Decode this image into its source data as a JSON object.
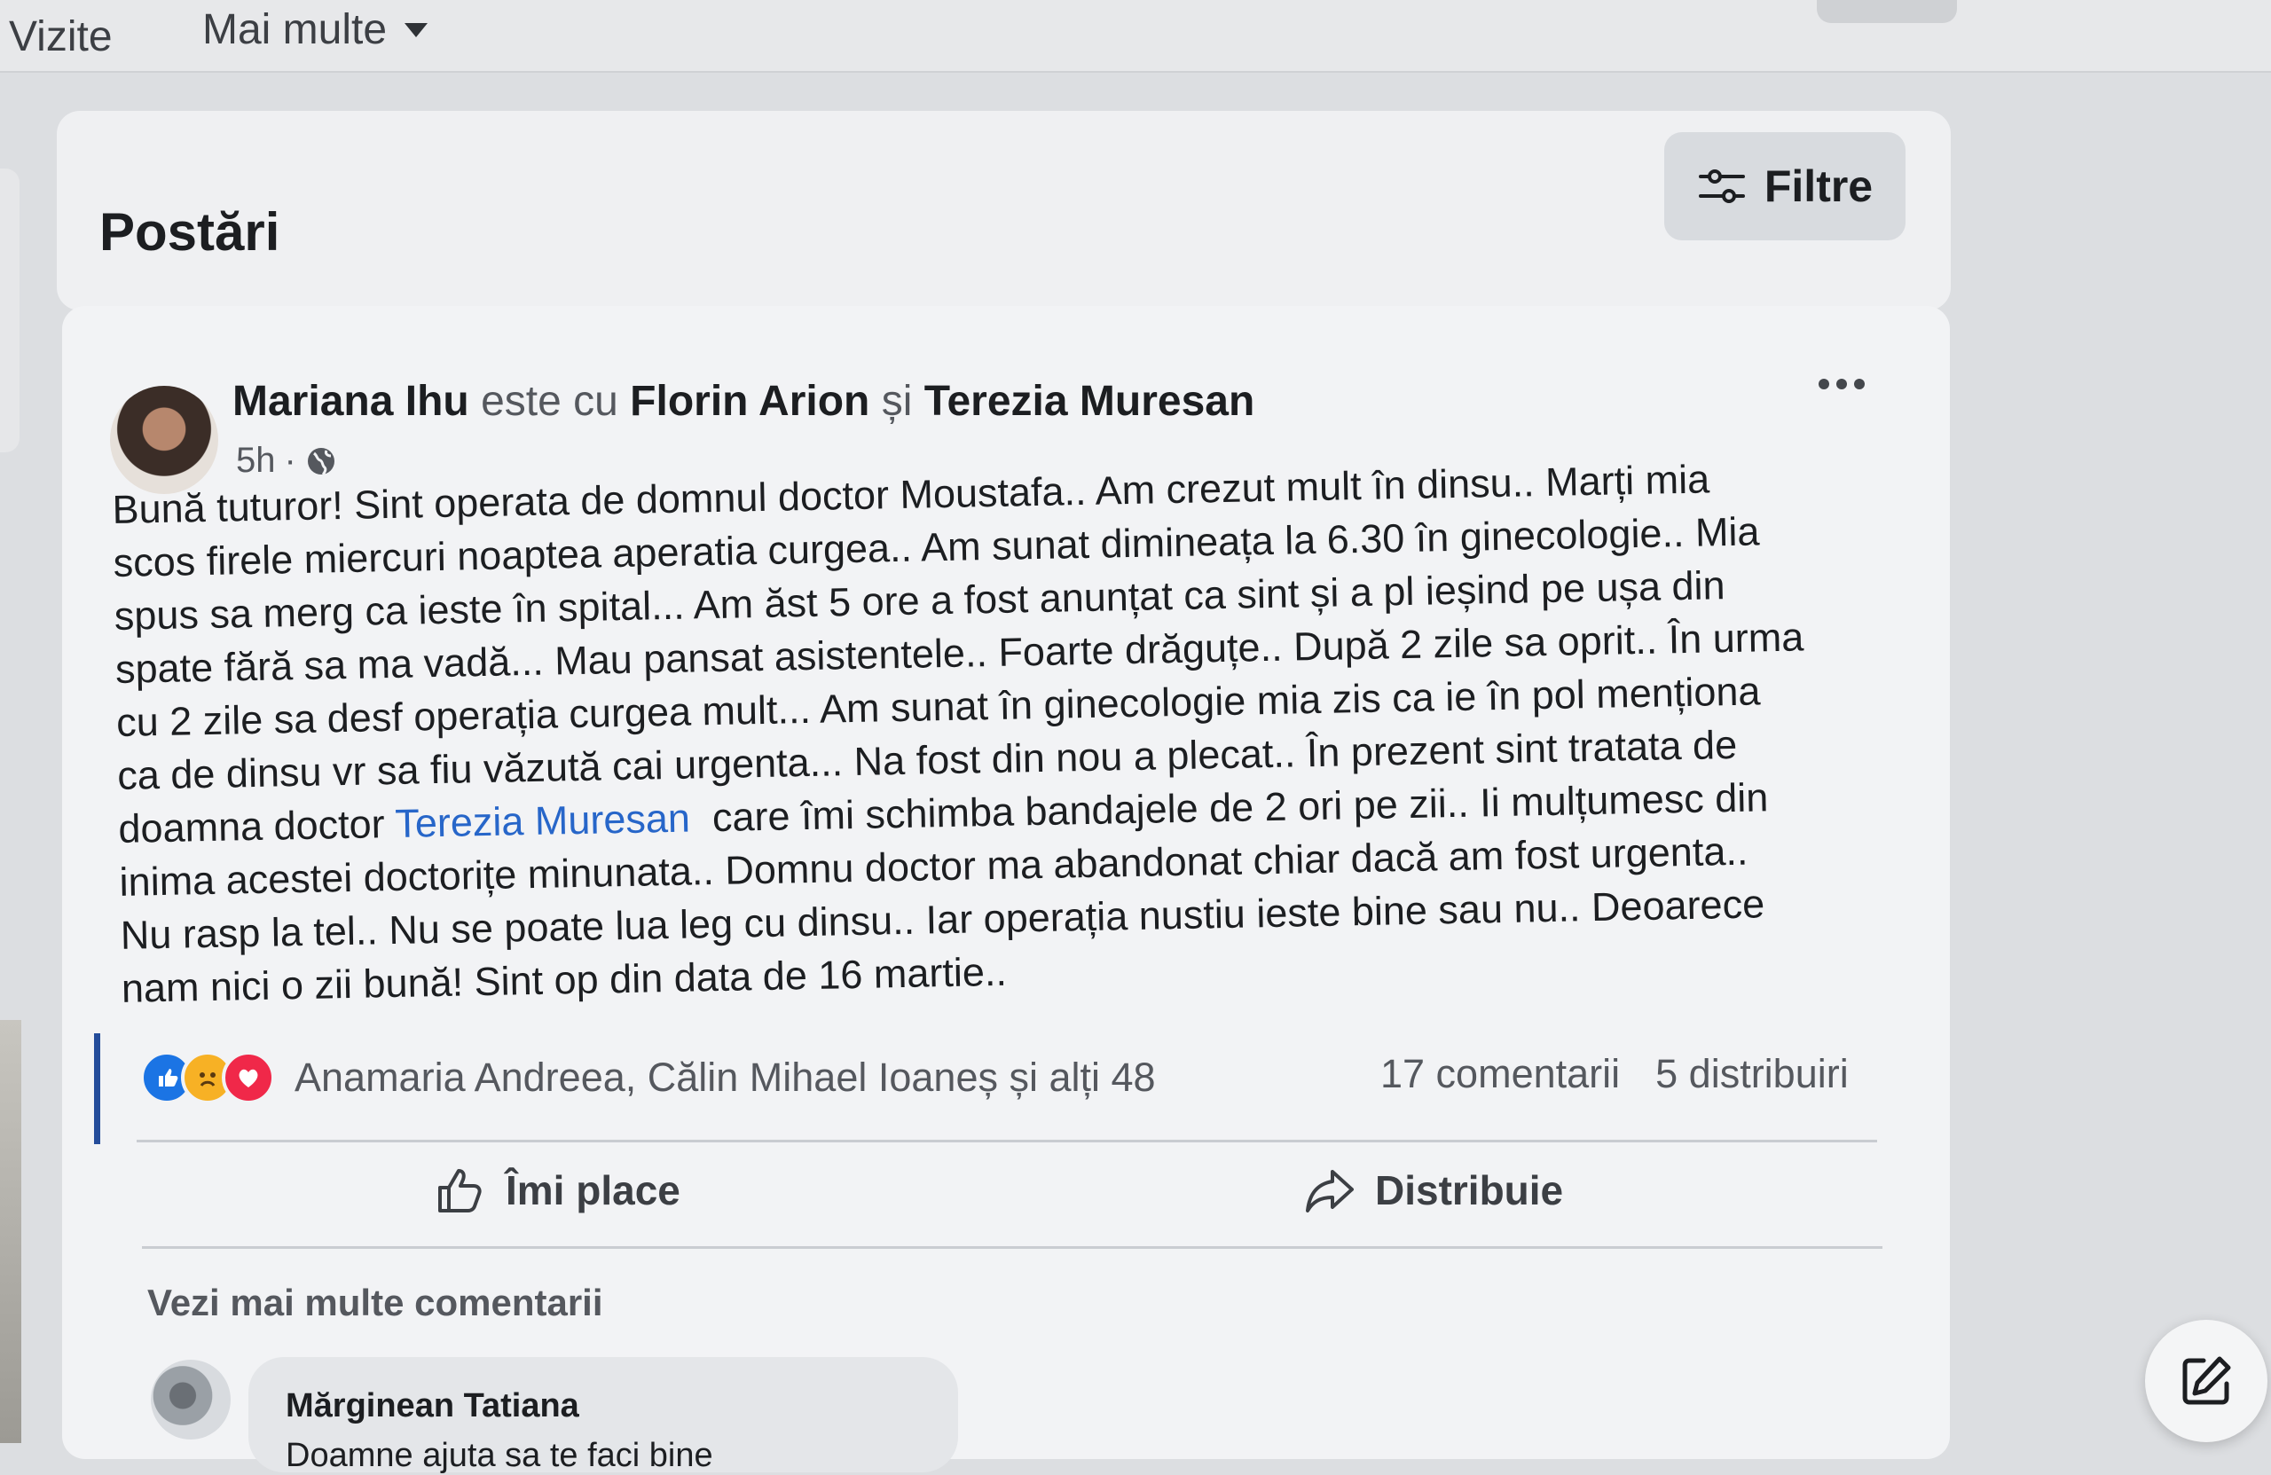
{
  "nav": {
    "items": [
      "Vizite",
      "Mai multe"
    ]
  },
  "posts_section": {
    "title": "Postări",
    "filter_label": "Filtre"
  },
  "post": {
    "author": "Mariana Ihu",
    "with_text": "este cu",
    "tagged_1": "Florin Arion",
    "and_text": "și",
    "tagged_2": "Terezia Muresan",
    "time": "5h",
    "separator": "·",
    "body_lines": [
      "Bună tuturor! Sint operata de domnul doctor  Moustafa.. Am crezut mult în dinsu.. Marți mia",
      "scos firele miercuri noaptea aperatia curgea.. Am sunat dimineața la 6.30 în ginecologie.. Mia",
      "spus sa merg ca ieste în spital... Am ăst 5 ore a fost anunțat ca sint și a pl ieșind pe ușa din",
      "spate fără sa ma vadă... Mau pansat asistentele.. Foarte drăguțe.. După 2 zile sa oprit.. În urma",
      "cu 2 zile sa desf operația curgea mult... Am sunat în ginecologie mia zis ca ie în pol menționa",
      "ca de dinsu vr sa fiu văzută cai urgenta... Na fost din nou a plecat.. În prezent sint tratata de"
    ],
    "line7_before": "doamna doctor ",
    "line7_mention": "Terezia Muresan",
    "line7_after": "  care îmi schimba bandajele de 2 ori pe zii.. Ii mulțumesc din",
    "body_lines_2": [
      "inima acestei doctorițe minunata.. Domnu doctor ma abandonat chiar dacă am fost urgenta..",
      "Nu rasp la tel.. Nu se poate lua leg cu dinsu.. Iar operația nustiu ieste bine sau nu.. Deoarece",
      "nam nici o zii bună! Sint op din data de 16 martie.."
    ],
    "reactions_text": "Anamaria Andreea, Călin Mihael Ioaneș și alți 48",
    "comments_count": "17 comentarii",
    "shares_count": "5 distribuiri",
    "like_label": "Îmi place",
    "share_label": "Distribuie",
    "more_comments": "Vezi mai multe comentarii",
    "comment": {
      "name": "Mărginean Tatiana",
      "text": "Doamne ajuta sa te faci bine"
    }
  },
  "colors": {
    "like_blue": "#1b74e4",
    "sad_yellow": "#f7b125",
    "love_red": "#f02849",
    "mention_blue": "#2766c9"
  },
  "icons": [
    "chevron-down-icon",
    "filter-icon",
    "globe-icon",
    "more-dots-icon",
    "like-reaction-icon",
    "sad-reaction-icon",
    "love-reaction-icon",
    "thumbs-up-icon",
    "share-arrow-icon",
    "compose-icon"
  ]
}
